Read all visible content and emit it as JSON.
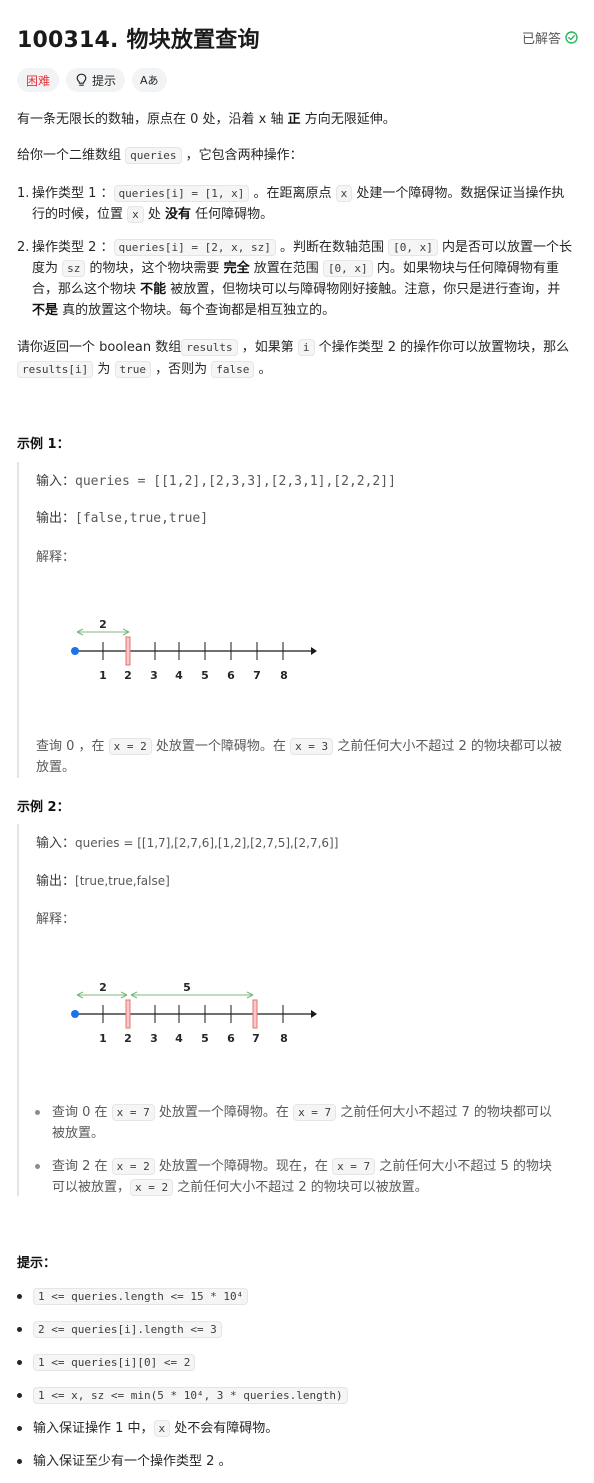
{
  "header": {
    "title": "100314. 物块放置查询",
    "solved_label": "已解答"
  },
  "tags": {
    "difficulty": "困难",
    "hint": "提示",
    "translate": "Aあ"
  },
  "description": {
    "p1_a": "有一条无限长的数轴，原点在 0 处，沿着 x 轴 ",
    "p1_b": "正",
    "p1_c": " 方向无限延伸。",
    "p2_a": "给你一个二维数组 ",
    "p2_code": "queries",
    "p2_b": " ，它包含两种操作：",
    "op1": {
      "num": "1.",
      "a": "操作类型 1 ：",
      "code1": "queries[i] = [1, x]",
      "b": " 。在距离原点 ",
      "code2": "x",
      "c": " 处建一个障碍物。数据保证当操作执行的时候，位置 ",
      "code3": "x",
      "d": " 处 ",
      "bold": "没有",
      "e": " 任何障碍物。"
    },
    "op2": {
      "num": "2.",
      "a": "操作类型 2 ：",
      "code1": "queries[i] = [2, x, sz]",
      "b": " 。判断在数轴范围 ",
      "code2": "[0, x]",
      "c": " 内是否可以放置一个长度为 ",
      "code3": "sz",
      "d": " 的物块，这个物块需要 ",
      "bold1": "完全",
      "e": " 放置在范围 ",
      "code4": "[0, x]",
      "f": " 内。如果物块与任何障碍物有重合，那么这个物块 ",
      "bold2": "不能",
      "g": " 被放置，但物块可以与障碍物刚好接触。注意，你只是进行查询，并 ",
      "bold3": "不是",
      "h": " 真的放置这个物块。每个查询都是相互独立的。"
    },
    "p3_a": "请你返回一个 boolean 数组",
    "p3_code1": "results",
    "p3_b": " ，如果第 ",
    "p3_code2": "i",
    "p3_c": " 个操作类型 2 的操作你可以放置物块，那么 ",
    "p3_code3": "results[i]",
    "p3_d": " 为 ",
    "p3_code4": "true",
    "p3_e": " ，否则为 ",
    "p3_code5": "false",
    "p3_f": " 。"
  },
  "example1": {
    "heading": "示例 1：",
    "input_label": "输入：",
    "input_value": "queries = [[1,2],[2,3,3],[2,3,1],[2,2,2]]",
    "output_label": "输出：",
    "output_value": "[false,true,true]",
    "explain_label": "解释：",
    "figure": {
      "ticks": [
        "1",
        "2",
        "3",
        "4",
        "5",
        "6",
        "7",
        "8"
      ],
      "span_label": "2"
    },
    "note_a": "查询 0 ，在 ",
    "note_code1": "x = 2",
    "note_b": " 处放置一个障碍物。在 ",
    "note_code2": "x = 3",
    "note_c": " 之前任何大小不超过 2 的物块都可以被放置。"
  },
  "example2": {
    "heading": "示例 2：",
    "input_label": "输入：",
    "input_value": "queries = [[1,7],[2,7,6],[1,2],[2,7,5],[2,7,6]]",
    "output_label": "输出：",
    "output_value": "[true,true,false]",
    "explain_label": "解释：",
    "figure": {
      "ticks": [
        "1",
        "2",
        "3",
        "4",
        "5",
        "6",
        "7",
        "8"
      ],
      "span1_label": "2",
      "span2_label": "5"
    },
    "bullet1": {
      "a": "查询 0 在 ",
      "code1": "x = 7",
      "b": " 处放置一个障碍物。在 ",
      "code2": "x = 7",
      "c": " 之前任何大小不超过 7 的物块都可以被放置。"
    },
    "bullet2": {
      "a": "查询 2 在 ",
      "code1": "x = 2",
      "b": " 处放置一个障碍物。现在，在 ",
      "code2": "x = 7",
      "c": " 之前任何大小不超过 5 的物块可以被放置，",
      "code3": "x = 2",
      "d": " 之前任何大小不超过 2 的物块可以被放置。"
    }
  },
  "constraints": {
    "heading": "提示：",
    "c1": "1 <= queries.length <= 15 * 10⁴",
    "c2": "2 <= queries[i].length <= 3",
    "c3": "1 <= queries[i][0] <= 2",
    "c4": "1 <= x, sz <= min(5 * 10⁴, 3 * queries.length)",
    "c5_a": "输入保证操作 1 中，",
    "c5_code": "x",
    "c5_b": " 处不会有障碍物。",
    "c6": "输入保证至少有一个操作类型 2 。"
  },
  "colors": {
    "hard": "#e8333b",
    "solved_check": "#2db55d",
    "axis_dot": "#1a73e8",
    "obstacle": "#e57373",
    "span_arrow": "#7cb87c"
  }
}
